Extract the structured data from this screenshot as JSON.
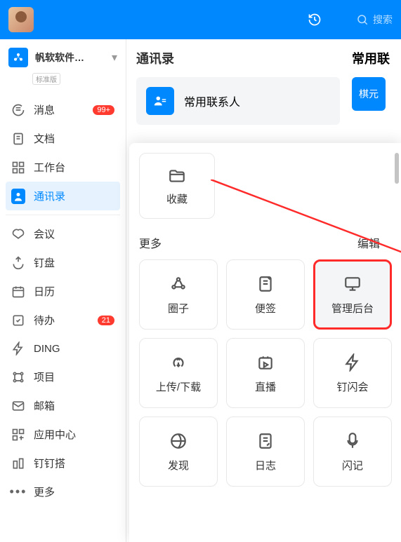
{
  "search": {
    "placeholder": "搜索"
  },
  "org": {
    "name": "帆软软件…",
    "badge": "标准版"
  },
  "nav": {
    "items": [
      {
        "label": "消息",
        "badge": "99+"
      },
      {
        "label": "文档"
      },
      {
        "label": "工作台"
      },
      {
        "label": "通讯录",
        "active": true
      },
      {
        "label": "会议"
      },
      {
        "label": "钉盘"
      },
      {
        "label": "日历"
      },
      {
        "label": "待办",
        "badge": "21"
      },
      {
        "label": "DING"
      },
      {
        "label": "项目"
      },
      {
        "label": "邮箱"
      },
      {
        "label": "应用中心"
      },
      {
        "label": "钉钉搭"
      },
      {
        "label": "更多"
      }
    ]
  },
  "content": {
    "contacts_title": "通讯录",
    "frequent_title": "常用联",
    "frequent_contacts": "常用联系人",
    "right_box": "棋元"
  },
  "popup": {
    "favorites": "收藏",
    "more": "更多",
    "edit": "编辑",
    "tiles": [
      {
        "label": "圈子"
      },
      {
        "label": "便签"
      },
      {
        "label": "管理后台",
        "highlight": true
      },
      {
        "label": "上传/下载"
      },
      {
        "label": "直播"
      },
      {
        "label": "钉闪会"
      },
      {
        "label": "发现"
      },
      {
        "label": "日志"
      },
      {
        "label": "闪记"
      }
    ]
  }
}
